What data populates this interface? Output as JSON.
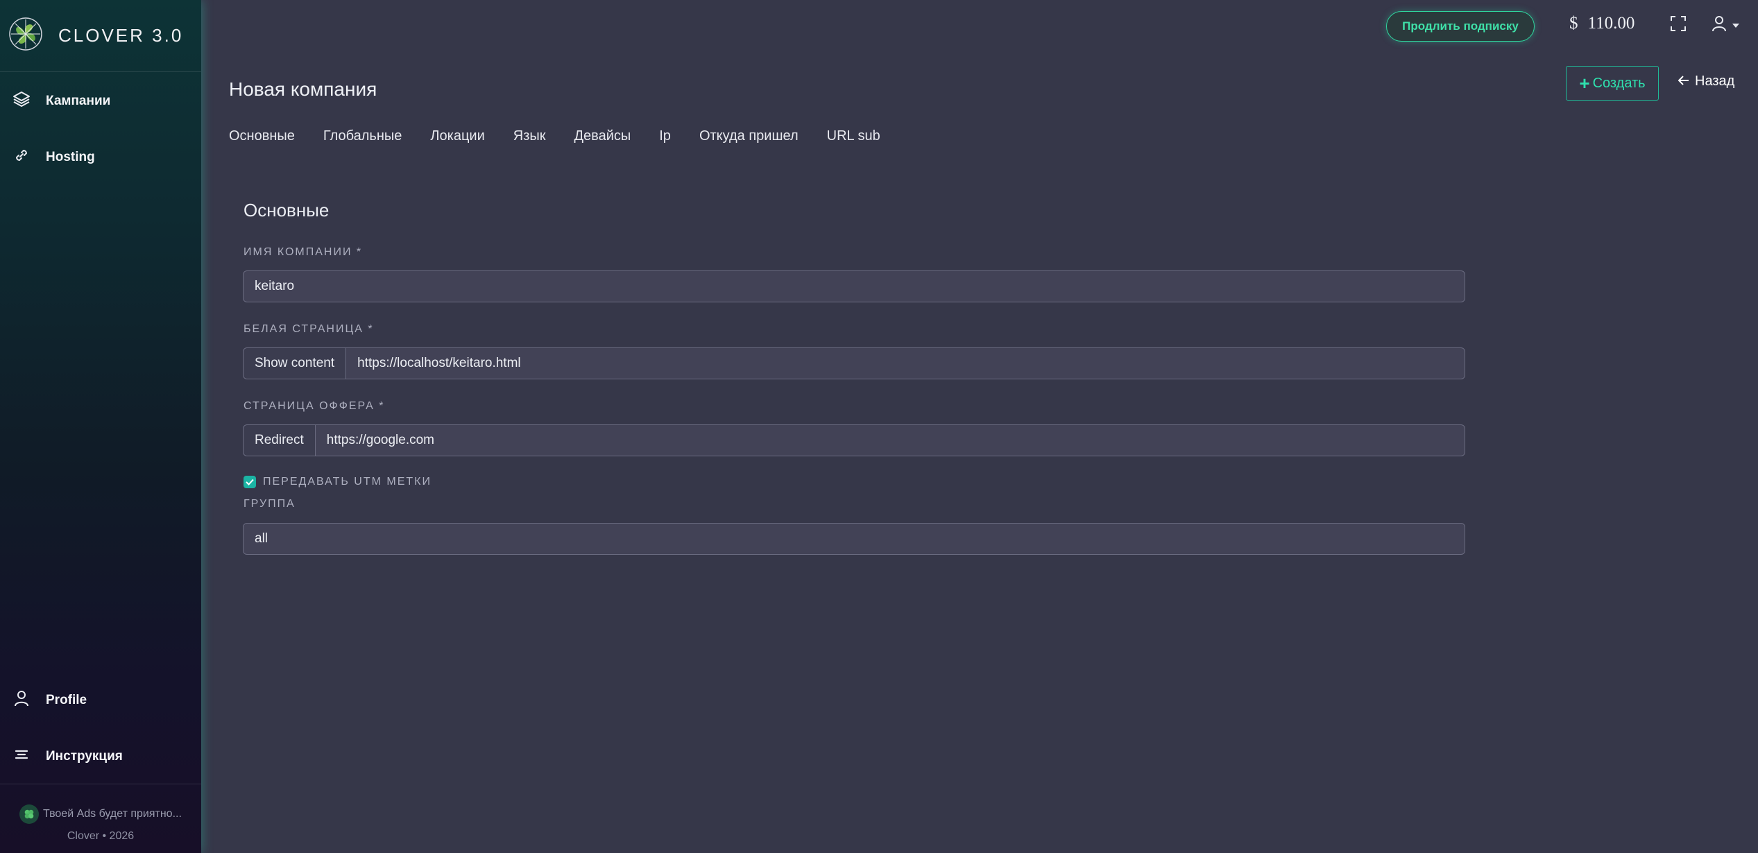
{
  "sidebar": {
    "brand": "CLOVER 3.0",
    "nav": [
      {
        "label": "Кампании",
        "icon": "layers-icon"
      },
      {
        "label": "Hosting",
        "icon": "link-icon"
      }
    ],
    "bottom_nav": [
      {
        "label": "Profile",
        "icon": "user-icon"
      },
      {
        "label": "Инструкция",
        "icon": "stack-icon"
      }
    ],
    "footer_tagline": "Твоей Ads будет приятно...",
    "footer_copyright": "Clover • 2026"
  },
  "topbar": {
    "renew_label": "Продлить подписку",
    "currency": "$",
    "balance": "110.00"
  },
  "header": {
    "title": "Новая компания",
    "create_label": "Создать",
    "back_label": "Назад"
  },
  "tabs": [
    "Основные",
    "Глобальные",
    "Локации",
    "Язык",
    "Девайсы",
    "Ip",
    "Откуда пришел",
    "URL sub"
  ],
  "form": {
    "section_title": "Основные",
    "company_name_label": "ИМЯ КОМПАНИИ *",
    "company_name_value": "keitaro",
    "white_page_label": "БЕЛАЯ СТРАНИЦА *",
    "white_page_mode": "Show content",
    "white_page_value": "https://localhost/keitaro.html",
    "offer_page_label": "СТРАНИЦА ОФФЕРА *",
    "offer_page_mode": "Redirect",
    "offer_page_value": "https://google.com",
    "utm_label": "ПЕРЕДАВАТЬ UTM МЕТКИ",
    "utm_checked": true,
    "group_label": "ГРУППА",
    "group_value": "all"
  },
  "colors": {
    "accent": "#2fd8a0",
    "background": "#363749",
    "checkbox": "#1bb4a4"
  }
}
